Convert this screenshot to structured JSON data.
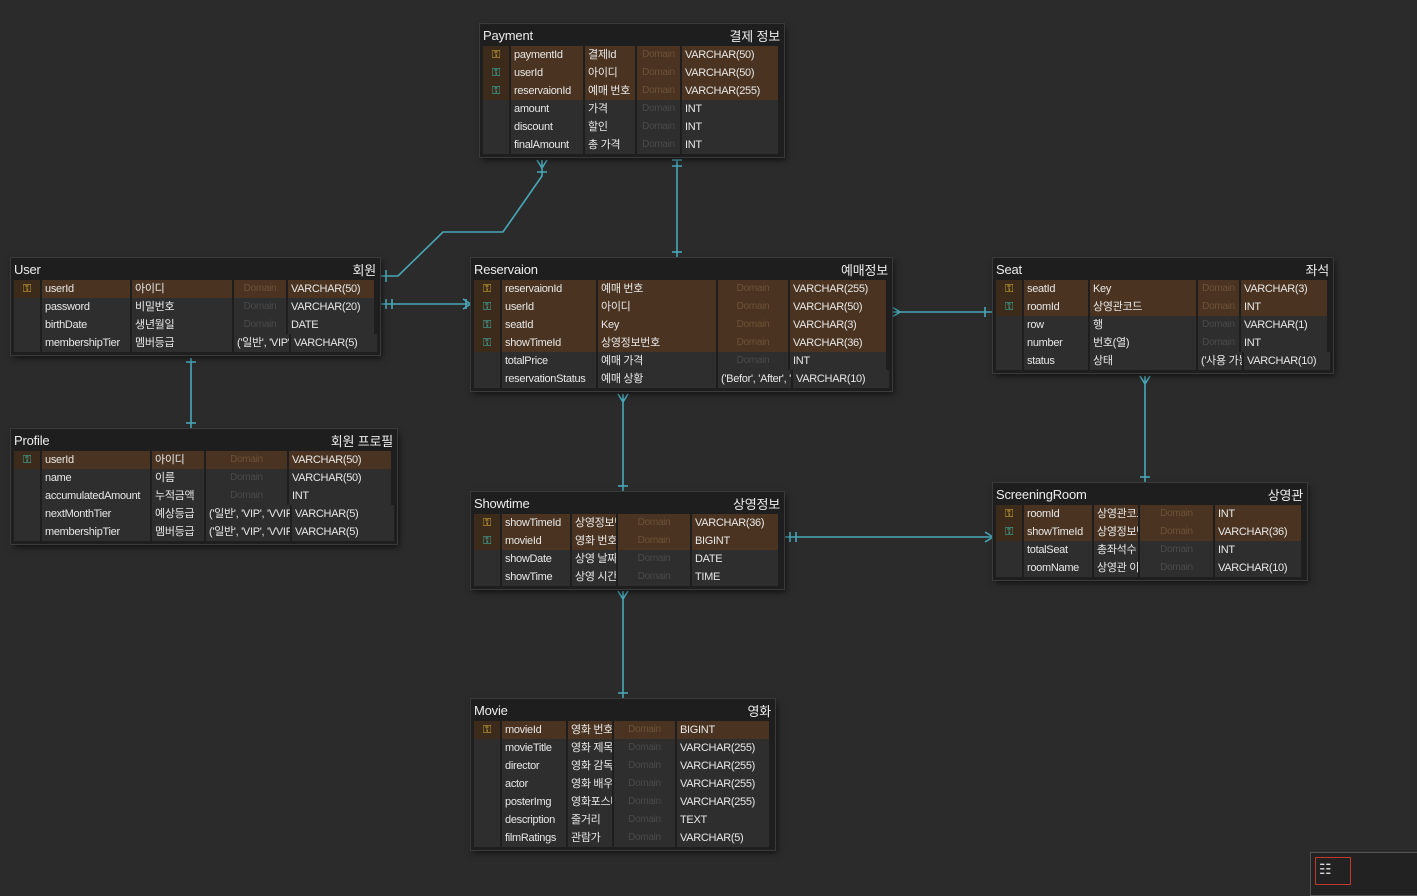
{
  "link_color": "#48a7b8",
  "pk_color": "#e0b83a",
  "fk_color": "#3cc6b8",
  "domain_placeholder": "Domain",
  "entities": [
    {
      "name": "Payment",
      "label": "결제 정보",
      "columns": [
        {
          "key": "pk",
          "name": "paymentId",
          "logical": "결제Id",
          "domain": "",
          "type": "VARCHAR(50)"
        },
        {
          "key": "fk",
          "name": "userId",
          "logical": "아이디",
          "domain": "",
          "type": "VARCHAR(50)"
        },
        {
          "key": "fk",
          "name": "reservaionId",
          "logical": "예매 번호",
          "domain": "",
          "type": "VARCHAR(255)"
        },
        {
          "key": "",
          "name": "amount",
          "logical": "가격",
          "domain": "",
          "type": "INT"
        },
        {
          "key": "",
          "name": "discount",
          "logical": "할인",
          "domain": "",
          "type": "INT"
        },
        {
          "key": "",
          "name": "finalAmount",
          "logical": "총 가격",
          "domain": "",
          "type": "INT"
        }
      ]
    },
    {
      "name": "User",
      "label": "회원",
      "columns": [
        {
          "key": "pk",
          "name": "userId",
          "logical": "아이디",
          "domain": "",
          "type": "VARCHAR(50)"
        },
        {
          "key": "",
          "name": "password",
          "logical": "비밀번호",
          "domain": "",
          "type": "VARCHAR(20)"
        },
        {
          "key": "",
          "name": "birthDate",
          "logical": "생년월일",
          "domain": "",
          "type": "DATE"
        },
        {
          "key": "",
          "name": "membershipTier",
          "logical": "멤버등급",
          "domain": "('일반', 'VIP', 'VVIP')",
          "type": "VARCHAR(5)"
        }
      ]
    },
    {
      "name": "Reservaion",
      "label": "예매정보",
      "columns": [
        {
          "key": "pk",
          "name": "reservaionId",
          "logical": "예매 번호",
          "domain": "",
          "type": "VARCHAR(255)"
        },
        {
          "key": "fk",
          "name": "userId",
          "logical": "아이디",
          "domain": "",
          "type": "VARCHAR(50)"
        },
        {
          "key": "fk",
          "name": "seatId",
          "logical": "Key",
          "domain": "",
          "type": "VARCHAR(3)"
        },
        {
          "key": "fk",
          "name": "showTimeId",
          "logical": "상영정보번호",
          "domain": "",
          "type": "VARCHAR(36)"
        },
        {
          "key": "",
          "name": "totalPrice",
          "logical": "예매 가격",
          "domain": "",
          "type": "INT"
        },
        {
          "key": "",
          "name": "reservationStatus",
          "logical": "예매 상황",
          "domain": "('Befor', 'After', 'Cancle')",
          "type": "VARCHAR(10)"
        }
      ]
    },
    {
      "name": "Seat",
      "label": "좌석",
      "columns": [
        {
          "key": "pk",
          "name": "seatId",
          "logical": "Key",
          "domain": "",
          "type": "VARCHAR(3)"
        },
        {
          "key": "fk",
          "name": "roomId",
          "logical": "상영관코드",
          "domain": "",
          "type": "INT"
        },
        {
          "key": "",
          "name": "row",
          "logical": "행",
          "domain": "",
          "type": "VARCHAR(1)"
        },
        {
          "key": "",
          "name": "number",
          "logical": "번호(열)",
          "domain": "",
          "type": "INT"
        },
        {
          "key": "",
          "name": "status",
          "logical": "상태",
          "domain": "('사용 가능', '예약됨')",
          "type": "VARCHAR(10)"
        }
      ]
    },
    {
      "name": "Profile",
      "label": "회원 프로필",
      "columns": [
        {
          "key": "fk",
          "name": "userId",
          "logical": "아이디",
          "domain": "",
          "type": "VARCHAR(50)"
        },
        {
          "key": "",
          "name": "name",
          "logical": "이름",
          "domain": "",
          "type": "VARCHAR(50)"
        },
        {
          "key": "",
          "name": "accumulatedAmount",
          "logical": "누적금액",
          "domain": "",
          "type": "INT"
        },
        {
          "key": "",
          "name": "nextMonthTier",
          "logical": "예상등급",
          "domain": "('일반', 'VIP', 'VVIP')",
          "type": "VARCHAR(5)"
        },
        {
          "key": "",
          "name": "membershipTier",
          "logical": "멤버등급",
          "domain": "('일반', 'VIP', 'VVIP')",
          "type": "VARCHAR(5)"
        }
      ]
    },
    {
      "name": "Showtime",
      "label": "상영정보",
      "columns": [
        {
          "key": "pk",
          "name": "showTimeId",
          "logical": "상영정보번호",
          "domain": "",
          "type": "VARCHAR(36)"
        },
        {
          "key": "fk",
          "name": "movieId",
          "logical": "영화 번호",
          "domain": "",
          "type": "BIGINT"
        },
        {
          "key": "",
          "name": "showDate",
          "logical": "상영 날짜",
          "domain": "",
          "type": "DATE"
        },
        {
          "key": "",
          "name": "showTime",
          "logical": "상영 시간",
          "domain": "",
          "type": "TIME"
        }
      ]
    },
    {
      "name": "ScreeningRoom",
      "label": "상영관",
      "columns": [
        {
          "key": "pk",
          "name": "roomId",
          "logical": "상영관코드",
          "domain": "",
          "type": "INT"
        },
        {
          "key": "fk",
          "name": "showTimeId",
          "logical": "상영정보번호",
          "domain": "",
          "type": "VARCHAR(36)"
        },
        {
          "key": "",
          "name": "totalSeat",
          "logical": "총좌석수",
          "domain": "",
          "type": "INT"
        },
        {
          "key": "",
          "name": "roomName",
          "logical": "상영관 이름",
          "domain": "",
          "type": "VARCHAR(10)"
        }
      ]
    },
    {
      "name": "Movie",
      "label": "영화",
      "columns": [
        {
          "key": "pk",
          "name": "movieId",
          "logical": "영화 번호",
          "domain": "",
          "type": "BIGINT"
        },
        {
          "key": "",
          "name": "movieTitle",
          "logical": "영화 제목",
          "domain": "",
          "type": "VARCHAR(255)"
        },
        {
          "key": "",
          "name": "director",
          "logical": "영화 감독",
          "domain": "",
          "type": "VARCHAR(255)"
        },
        {
          "key": "",
          "name": "actor",
          "logical": "영화 배우",
          "domain": "",
          "type": "VARCHAR(255)"
        },
        {
          "key": "",
          "name": "posterImg",
          "logical": "영화포스터",
          "domain": "",
          "type": "VARCHAR(255)"
        },
        {
          "key": "",
          "name": "description",
          "logical": "줄거리",
          "domain": "",
          "type": "TEXT"
        },
        {
          "key": "",
          "name": "filmRatings",
          "logical": "관람가",
          "domain": "",
          "type": "VARCHAR(5)"
        }
      ]
    }
  ]
}
